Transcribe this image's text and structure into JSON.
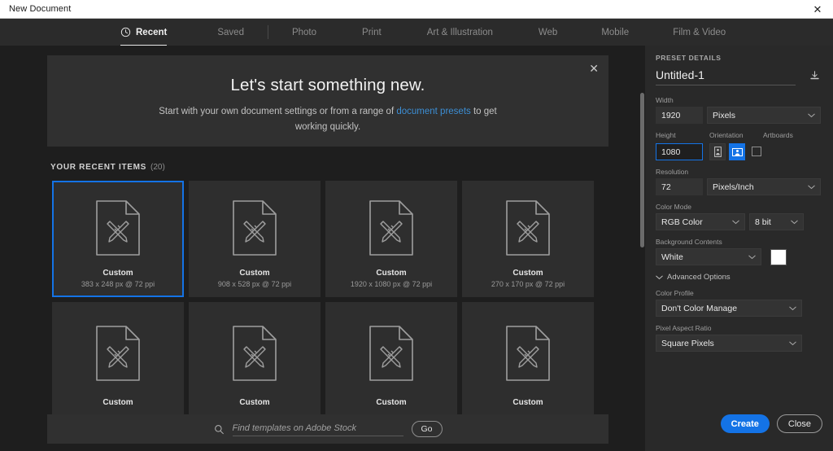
{
  "window": {
    "title": "New Document",
    "close_icon": "close-icon"
  },
  "tabs": [
    {
      "label": "Recent",
      "icon": "clock-icon",
      "active": true
    },
    {
      "label": "Saved",
      "active": false
    },
    {
      "label": "Photo",
      "active": false
    },
    {
      "label": "Print",
      "active": false
    },
    {
      "label": "Art & Illustration",
      "active": false
    },
    {
      "label": "Web",
      "active": false
    },
    {
      "label": "Mobile",
      "active": false
    },
    {
      "label": "Film & Video",
      "active": false
    }
  ],
  "banner": {
    "title": "Let's start something new.",
    "text_before": "Start with your own document settings or from a range of ",
    "link": "document presets",
    "text_after": " to get working quickly.",
    "close_icon": "close-icon"
  },
  "recent": {
    "heading": "YOUR RECENT ITEMS",
    "count": "(20)",
    "items": [
      {
        "title": "Custom",
        "dims": "383 x 248 px @ 72 ppi",
        "selected": true
      },
      {
        "title": "Custom",
        "dims": "908 x 528 px @ 72 ppi",
        "selected": false
      },
      {
        "title": "Custom",
        "dims": "1920 x 1080 px @ 72 ppi",
        "selected": false
      },
      {
        "title": "Custom",
        "dims": "270 x 170 px @ 72 ppi",
        "selected": false
      },
      {
        "title": "Custom",
        "dims": "",
        "selected": false
      },
      {
        "title": "Custom",
        "dims": "",
        "selected": false
      },
      {
        "title": "Custom",
        "dims": "",
        "selected": false
      },
      {
        "title": "Custom",
        "dims": "",
        "selected": false
      }
    ]
  },
  "stock": {
    "placeholder": "Find templates on Adobe Stock",
    "value": "",
    "go_label": "Go",
    "search_icon": "search-icon"
  },
  "panel": {
    "heading": "PRESET DETAILS",
    "preset_name": "Untitled-1",
    "save_preset_icon": "save-preset-icon",
    "width": {
      "label": "Width",
      "value": "1920",
      "unit": "Pixels"
    },
    "height": {
      "label": "Height",
      "value": "1080"
    },
    "orientation": {
      "label": "Orientation",
      "portrait_icon": "portrait-icon",
      "landscape_icon": "landscape-icon",
      "selected": "landscape"
    },
    "artboards": {
      "label": "Artboards",
      "checked": false
    },
    "resolution": {
      "label": "Resolution",
      "value": "72",
      "unit": "Pixels/Inch"
    },
    "color_mode": {
      "label": "Color Mode",
      "value": "RGB Color",
      "depth": "8 bit"
    },
    "background": {
      "label": "Background Contents",
      "value": "White",
      "swatch": "#ffffff"
    },
    "advanced": {
      "label": "Advanced Options",
      "expanded": true
    },
    "color_profile": {
      "label": "Color Profile",
      "value": "Don't Color Manage"
    },
    "pixel_aspect": {
      "label": "Pixel Aspect Ratio",
      "value": "Square Pixels"
    },
    "create_label": "Create",
    "close_label": "Close"
  },
  "colors": {
    "accent": "#1473e6",
    "link": "#3c8ed4",
    "panel_bg": "#292929",
    "content_bg": "#1e1e1e",
    "card_bg": "#2e2e2e"
  }
}
